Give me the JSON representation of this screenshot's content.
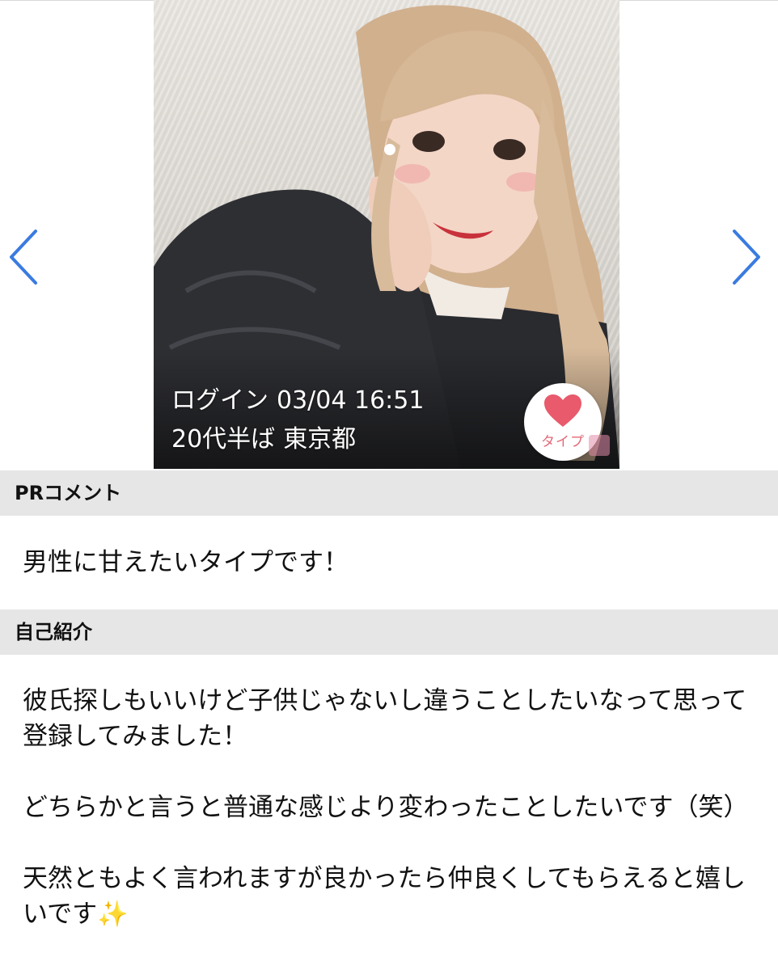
{
  "colors": {
    "accent_arrow": "#3a7be0",
    "heart": "#e85a6c",
    "section_bg": "#e6e6e6"
  },
  "carousel": {
    "prev_icon": "chevron-left-icon",
    "next_icon": "chevron-right-icon"
  },
  "profile": {
    "login_label": "ログイン",
    "login_time": "03/04 16:51",
    "age": "20代半ば",
    "location": "東京都",
    "like_label": "タイプ",
    "like_icon": "heart-icon"
  },
  "pr": {
    "heading": "PRコメント",
    "text": "男性に甘えたいタイプです！"
  },
  "intro": {
    "heading": "自己紹介",
    "text": "彼氏探しもいいけど子供じゃないし違うことしたいなって思って登録してみました！\n\nどちらかと言うと普通な感じより変わったことしたいです（笑）\n\n天然ともよく言われますが良かったら仲良くしてもらえると嬉しいです✨"
  }
}
